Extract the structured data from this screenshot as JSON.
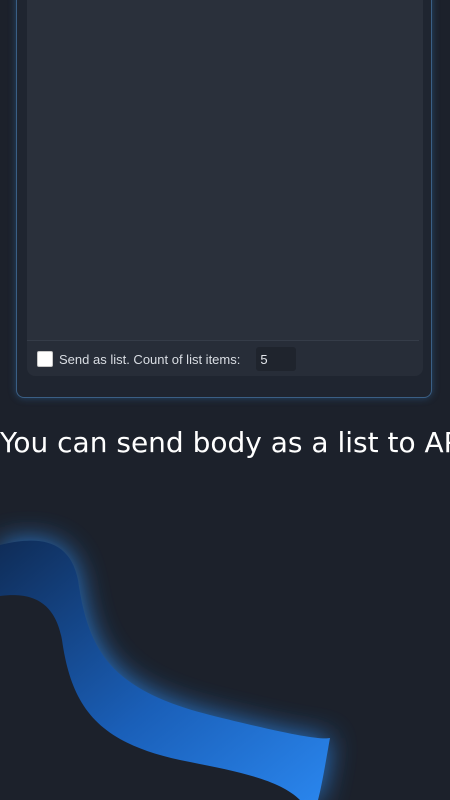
{
  "editor": {
    "send_as_list_label": "Send as list. Count of list items:",
    "list_count_value": "5",
    "send_as_list_checked": false
  },
  "caption": {
    "text": "You can send body as a list to API"
  },
  "colors": {
    "background": "#1c212b",
    "panel": "#272d38",
    "accent_glow": "#1e6fd0"
  }
}
